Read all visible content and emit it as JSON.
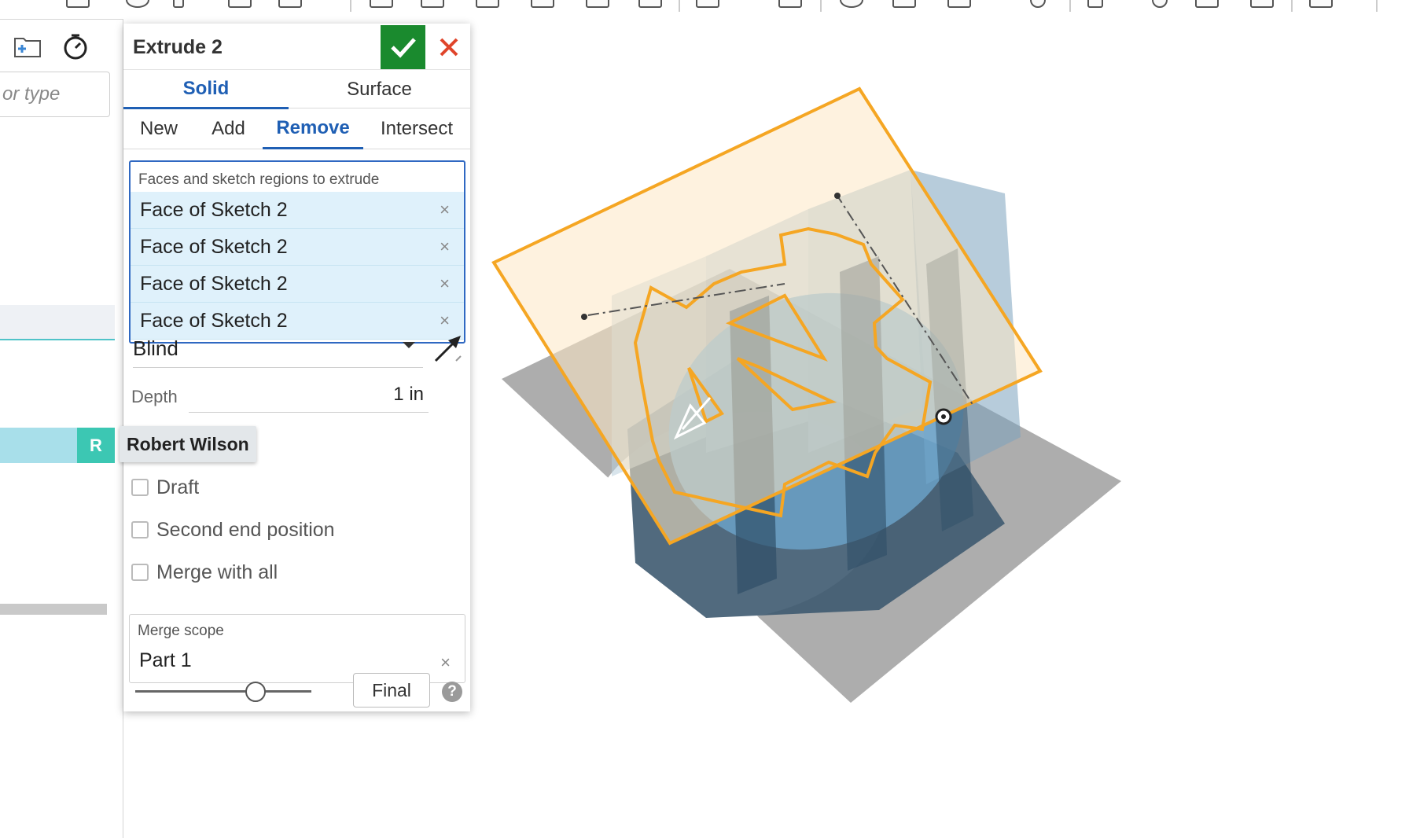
{
  "left_panel": {
    "search_placeholder": "or type",
    "user_badge_initial": "R",
    "tooltip_user": "Robert Wilson"
  },
  "dialog": {
    "title": "Extrude 2",
    "type_tabs": [
      "Solid",
      "Surface"
    ],
    "active_type_tab": "Solid",
    "op_tabs": [
      "New",
      "Add",
      "Remove",
      "Intersect"
    ],
    "active_op_tab": "Remove",
    "selection_label": "Faces and sketch regions to extrude",
    "selections": [
      "Face of Sketch 2",
      "Face of Sketch 2",
      "Face of Sketch 2",
      "Face of Sketch 2"
    ],
    "end_type": "Blind",
    "depth_label": "Depth",
    "depth_value": "1 in",
    "checkboxes": [
      "Draft",
      "Second end position",
      "Merge with all"
    ],
    "merge_scope_label": "Merge scope",
    "merge_scope_value": "Part 1",
    "final_label": "Final",
    "help_symbol": "?",
    "remove_symbol": "×"
  },
  "colors": {
    "accent_blue": "#1f5fb4",
    "ok_green": "#1a8a2e",
    "cancel_red": "#e0452b",
    "selection_bg": "#dff1fb",
    "plane_orange": "#f5a623",
    "plane_fill": "#fde7c4",
    "user_teal": "#3cc7b3"
  }
}
